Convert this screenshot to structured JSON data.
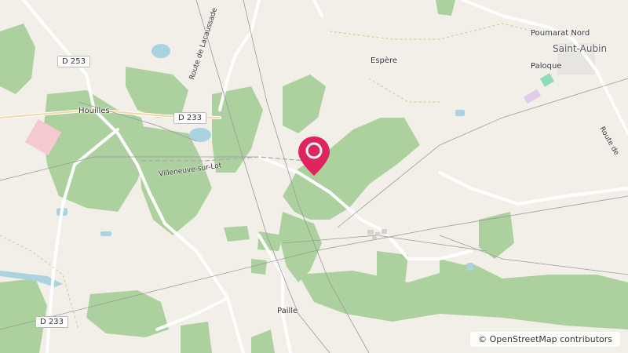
{
  "map": {
    "labels": {
      "houilles": "Houilles",
      "espere": "Espère",
      "poumarat_nord": "Poumarat Nord",
      "saint_aubin": "Saint-Aubin",
      "paloque": "Paloque",
      "paille": "Paille",
      "villeneuve": "Villeneuve-sur-Lot"
    },
    "road_shields": {
      "d253": "D 253",
      "d233_top": "D 233",
      "d233_bottom": "D 233"
    },
    "road_names": {
      "route_lacaussade": "Route de Lacaussade",
      "route_de": "Route de"
    },
    "attribution": "© OpenStreetMap contributors",
    "colors": {
      "background": "#f2efe9",
      "forest": "#add19e",
      "water": "#aad3df",
      "marker": "#e0245e"
    },
    "marker_icon": "map-pin-icon"
  }
}
